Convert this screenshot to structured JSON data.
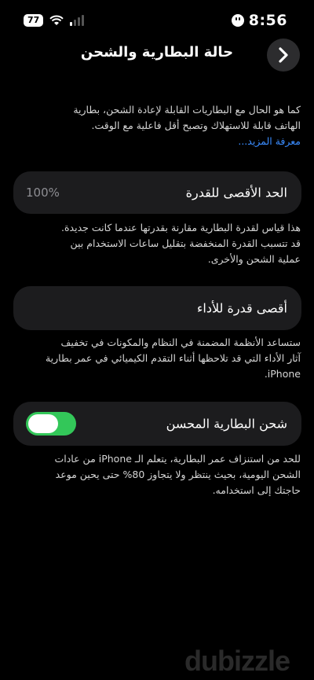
{
  "status_bar": {
    "battery_level": "77",
    "time": "8:56"
  },
  "header": {
    "title": "حالة البطارية والشحن"
  },
  "intro": {
    "line1": "كما هو الحال مع البطاريات القابلة لإعادة الشحن، بطارية",
    "line2": "الهاتف قابلة للاستهلاك وتصبح أقل فاعلية مع الوقت.",
    "learn_more": "معرفة المزيد..."
  },
  "max_capacity": {
    "label": "الحد الأقصى للقدرة",
    "value": "100%",
    "desc_line1": "هذا قياس لقدرة البطارية مقارنة بقدرتها عندما كانت جديدة.",
    "desc_line2": "قد تتسبب القدرة المنخفضة بتقليل ساعات الاستخدام بين",
    "desc_line3": "عملية الشحن والأخرى."
  },
  "peak_performance": {
    "label": "أقصى قدرة للأداء",
    "desc_line1": "ستساعد الأنظمة المضمنة في النظام والمكونات في تخفيف",
    "desc_line2": "آثار الأداء التي قد تلاحظها أثناء التقدم الكيميائي في عمر بطارية",
    "desc_line3": "iPhone."
  },
  "optimized_charging": {
    "label": "شحن البطارية المحسن",
    "enabled": true,
    "desc_line1": "للحد من استنزاف عمر البطارية، يتعلم الـ iPhone من عادات",
    "desc_line2": "الشحن اليومية، بحيث ينتظر ولا يتجاوز 80% حتى يحين موعد",
    "desc_line3": "حاجتك إلى استخدامه."
  },
  "watermark": "dubizzle",
  "colors": {
    "background": "#000000",
    "card": "#1c1c1e",
    "toggle_on": "#33c759",
    "link": "#3a8cff"
  }
}
